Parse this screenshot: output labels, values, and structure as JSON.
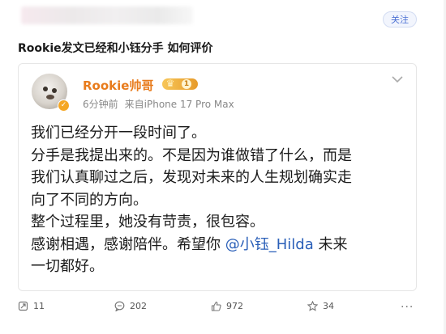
{
  "header": {
    "follow_label": "关注"
  },
  "question_title": "Rookie发文已经和小钰分手 如何评价",
  "post": {
    "author": "Rookie帅哥",
    "level": "1",
    "time": "6分钟前",
    "source": "来自iPhone 17 Pro Max",
    "lines": [
      "我们已经分开一段时间了。",
      "分手是我提出来的。不是因为谁做错了什么，而是",
      "我们认真聊过之后，发现对未来的人生规划确实走",
      "向了不同的方向。",
      "整个过程里，她没有苛责，很包容。"
    ],
    "last_line_pre": "感谢相遇，感谢陪伴。希望你 ",
    "mention": "@小钰_Hilda",
    "last_line_post": " 未来",
    "tail_line": "一切都好。"
  },
  "actions": {
    "repost_count": "11",
    "comment_count": "202",
    "like_count": "972",
    "favorite_count": "34",
    "more_label": "···"
  },
  "colors": {
    "author": "#e87b1c",
    "mention": "#2a5fb8",
    "follow": "#4a6fd3"
  }
}
